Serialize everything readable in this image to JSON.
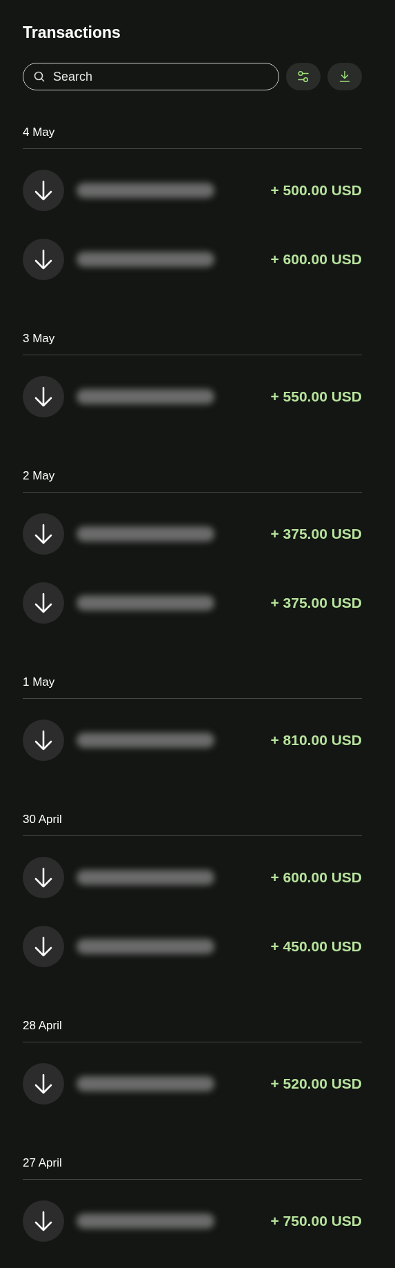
{
  "title": "Transactions",
  "search": {
    "placeholder": "Search"
  },
  "groups": [
    {
      "date": "4 May",
      "transactions": [
        {
          "amount": "+ 500.00 USD"
        },
        {
          "amount": "+ 600.00 USD"
        }
      ]
    },
    {
      "date": "3 May",
      "transactions": [
        {
          "amount": "+ 550.00 USD"
        }
      ]
    },
    {
      "date": "2 May",
      "transactions": [
        {
          "amount": "+ 375.00 USD"
        },
        {
          "amount": "+ 375.00 USD"
        }
      ]
    },
    {
      "date": "1 May",
      "transactions": [
        {
          "amount": "+ 810.00 USD"
        }
      ]
    },
    {
      "date": "30 April",
      "transactions": [
        {
          "amount": "+ 600.00 USD"
        },
        {
          "amount": "+ 450.00 USD"
        }
      ]
    },
    {
      "date": "28 April",
      "transactions": [
        {
          "amount": "+ 520.00 USD"
        }
      ]
    },
    {
      "date": "27 April",
      "transactions": [
        {
          "amount": "+ 750.00 USD"
        }
      ]
    }
  ]
}
